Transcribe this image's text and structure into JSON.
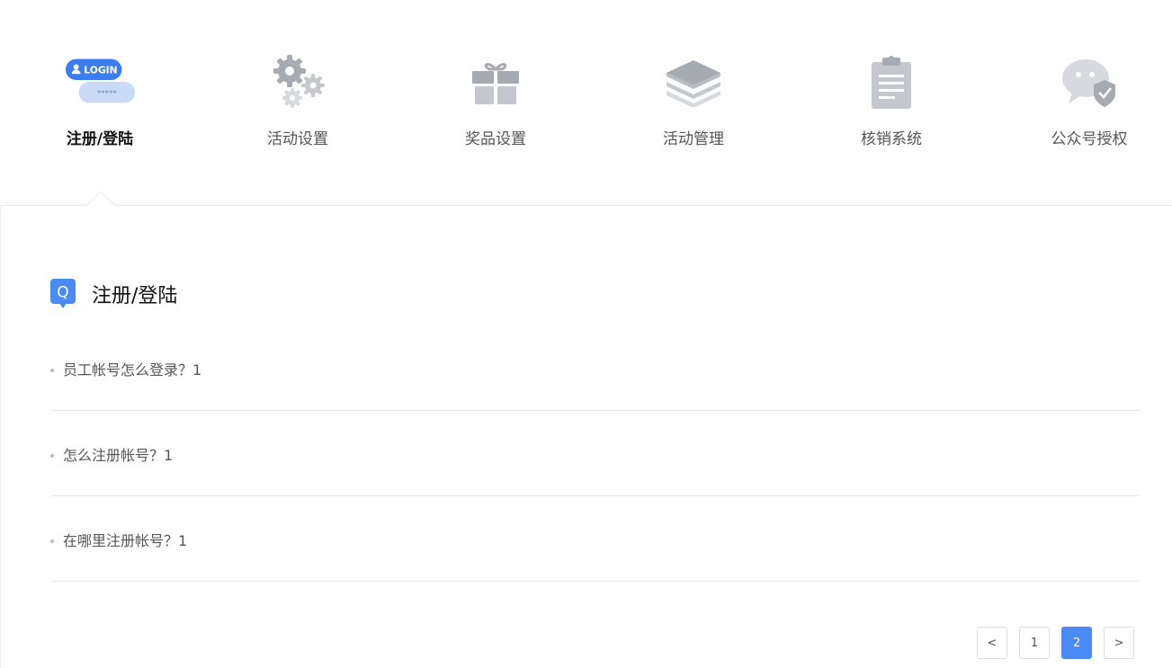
{
  "nav": {
    "items": [
      {
        "label": "注册/登陆",
        "icon": "login-icon",
        "active": true
      },
      {
        "label": "活动设置",
        "icon": "gears-icon"
      },
      {
        "label": "奖品设置",
        "icon": "gift-icon"
      },
      {
        "label": "活动管理",
        "icon": "layers-icon"
      },
      {
        "label": "核销系统",
        "icon": "clipboard-icon"
      },
      {
        "label": "公众号授权",
        "icon": "wechat-shield-icon"
      }
    ],
    "login_badge": "LOGIN",
    "login_password": "*****"
  },
  "section": {
    "icon_letter": "Q",
    "title": "注册/登陆"
  },
  "questions": [
    {
      "text": "员工帐号怎么登录？1"
    },
    {
      "text": "怎么注册帐号？1"
    },
    {
      "text": "在哪里注册帐号？1"
    }
  ],
  "pagination": {
    "prev": "<",
    "pages": [
      "1",
      "2"
    ],
    "current": "2",
    "next": ">"
  },
  "colors": {
    "accent": "#4a8af4",
    "icon_gray": "#a6aab1"
  }
}
